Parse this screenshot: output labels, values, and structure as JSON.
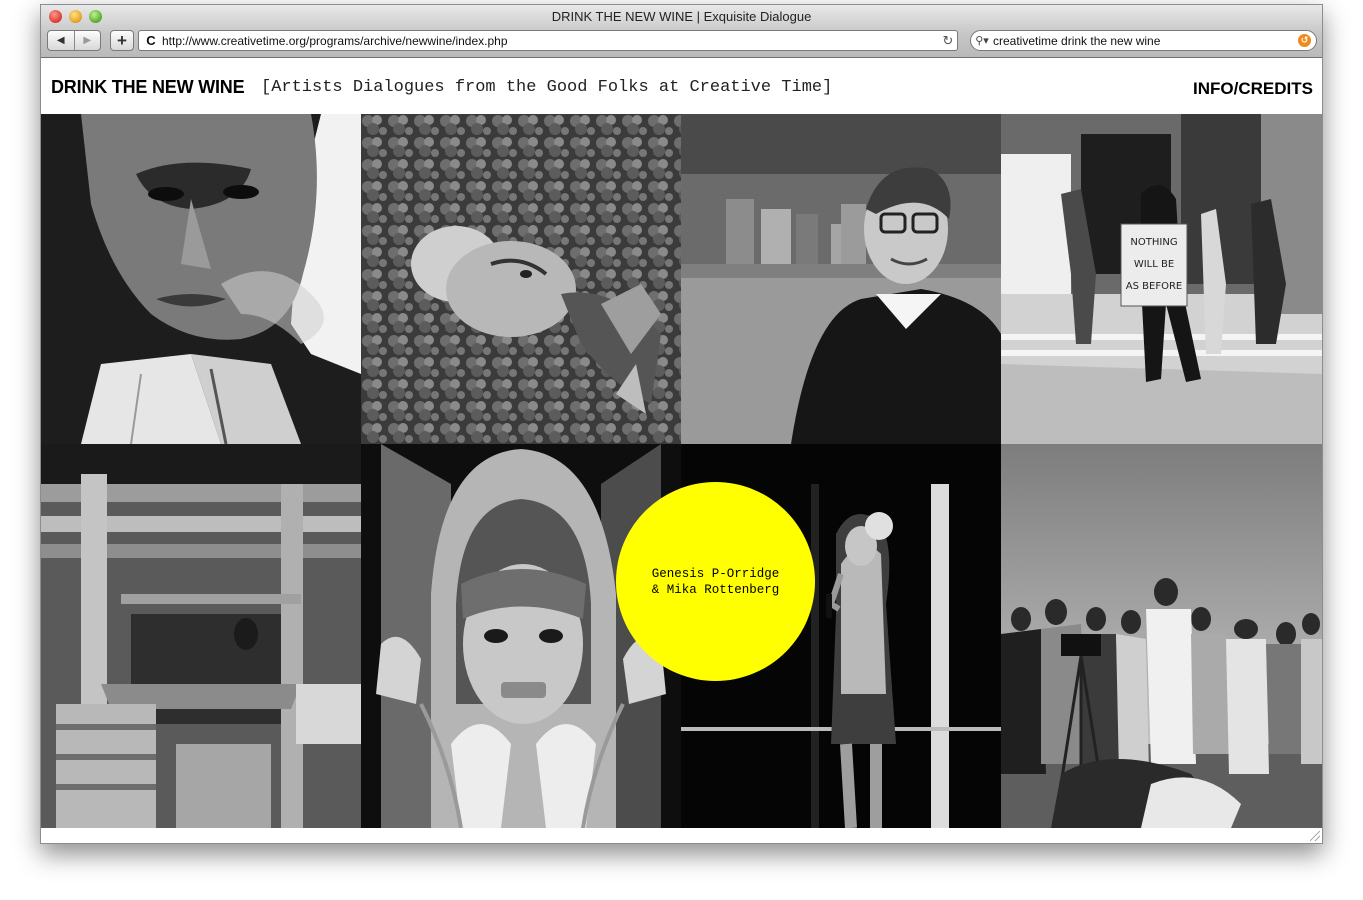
{
  "window": {
    "title": "DRINK THE NEW WINE | Exquisite Dialogue"
  },
  "toolbar": {
    "back_icon": "back-arrow",
    "forward_icon": "forward-arrow",
    "add_icon": "+",
    "url": "http://www.creativetime.org/programs/archive/newwine/index.php",
    "search_value": "creativetime drink the new wine"
  },
  "site": {
    "title": "DRINK THE NEW WINE",
    "tagline": "[Artists Dialogues from the Good Folks at Creative Time]",
    "info_link": "INFO/CREDITS"
  },
  "feature": {
    "line1": "Genesis P-Orridge",
    "line2": "& Mika Rottenberg"
  },
  "tiles": {
    "photo_sign": {
      "line1": "NOTHING",
      "line2": "WILL BE",
      "line3": "AS BEFORE"
    }
  },
  "colors": {
    "feature_circle": "#ffff00",
    "page_background": "#ffffff"
  }
}
